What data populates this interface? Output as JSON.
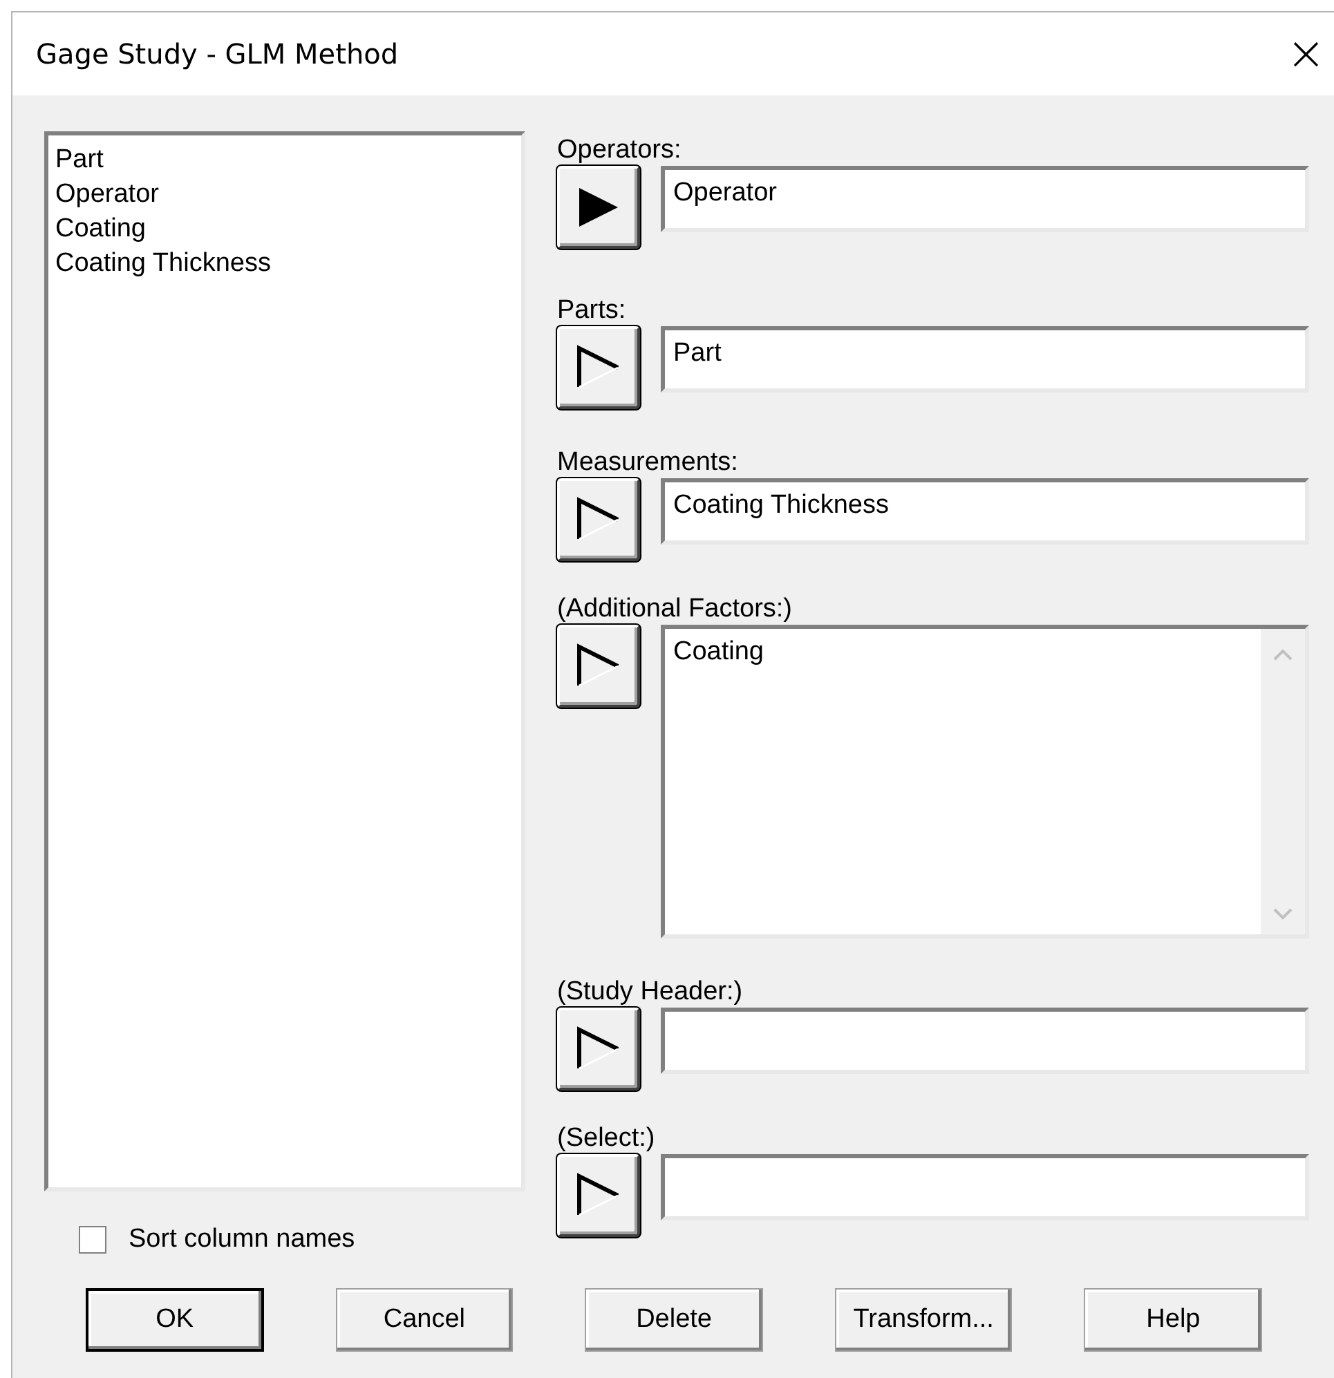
{
  "window": {
    "title": "Gage Study - GLM Method",
    "close": "×"
  },
  "columns": [
    "Part",
    "Operator",
    "Coating",
    "Coating Thickness"
  ],
  "sort_option": {
    "label": "Sort column names",
    "checked": false
  },
  "fields": [
    {
      "label": "Operators:",
      "kind": "single",
      "active": true,
      "values": [
        "Operator"
      ]
    },
    {
      "label": "Parts:",
      "kind": "single",
      "active": false,
      "values": [
        "Part"
      ]
    },
    {
      "label": "Measurements:",
      "kind": "single",
      "active": false,
      "values": [
        "Coating Thickness"
      ]
    },
    {
      "label": "(Additional Factors:)",
      "kind": "multi",
      "active": false,
      "values": [
        "Coating"
      ]
    },
    {
      "label": "(Study Header:)",
      "kind": "single",
      "active": false
    },
    {
      "label": "(Select:)",
      "kind": "single",
      "active": false
    }
  ],
  "buttons": [
    {
      "label": "OK",
      "default": true
    },
    {
      "label": "Cancel",
      "default": false
    },
    {
      "label": "Delete",
      "default": false
    },
    {
      "label": "Transform...",
      "default": false
    },
    {
      "label": "Help",
      "default": false
    }
  ]
}
